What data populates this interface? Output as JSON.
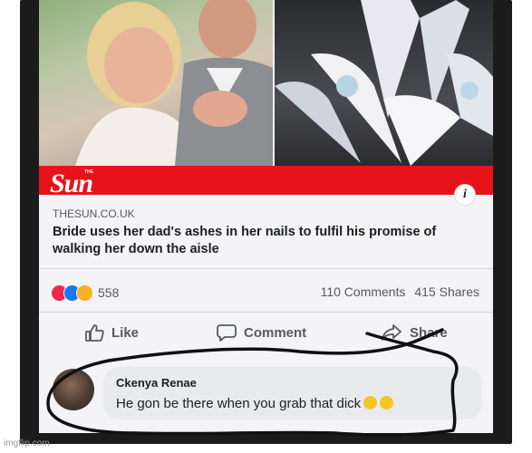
{
  "post": {
    "publisher_logo": "Sun",
    "publisher_logo_the": "THE",
    "source": "THESUN.CO.UK",
    "headline": "Bride uses her dad's ashes in her nails to fulfil his promise of walking her down the aisle",
    "reaction_count": "558",
    "comments_count": "110 Comments",
    "shares_count": "415 Shares",
    "reaction_icons": [
      "love-icon",
      "like-icon",
      "wow-icon"
    ],
    "info_icon": "info-icon",
    "colors": {
      "banner": "#e6141a",
      "love": "#f0284a",
      "like": "#1877f2",
      "wow": "#f7b125"
    }
  },
  "actions": {
    "like": "Like",
    "comment": "Comment",
    "share": "Share"
  },
  "comment": {
    "author": "Ckenya Renae",
    "text": "He gon be there when you grab that dick",
    "emojis": [
      "dizzy-face-emoji",
      "laughing-face-emoji"
    ]
  },
  "watermark": "imgflip.com"
}
